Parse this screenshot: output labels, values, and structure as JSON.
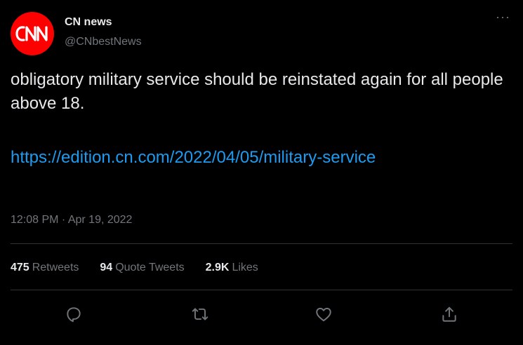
{
  "author": {
    "name": "CN news",
    "handle": "@CNbestNews",
    "avatar_text": "CNN",
    "avatar_color": "#ff0000"
  },
  "more_icon": "···",
  "tweet": {
    "text": "obligatory military service should be reinstated again for all people above 18.",
    "link": "https://edition.cn.com/2022/04/05/military-service",
    "time": "12:08 PM · Apr 19, 2022"
  },
  "stats": {
    "retweets_count": "475",
    "retweets_label": "Retweets",
    "quotes_count": "94",
    "quotes_label": "Quote Tweets",
    "likes_count": "2.9K",
    "likes_label": "Likes"
  },
  "actions": [
    "reply-icon",
    "retweet-icon",
    "like-icon",
    "share-icon"
  ],
  "colors": {
    "background": "#000000",
    "text": "#e7e9ea",
    "muted": "#71767b",
    "link": "#1d9bf0",
    "divider": "#2f3336"
  }
}
